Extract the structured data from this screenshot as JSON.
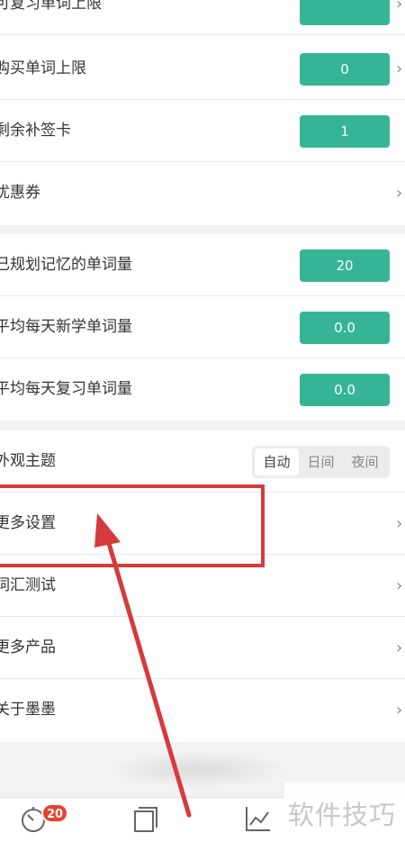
{
  "sections": {
    "top": {
      "rows": [
        {
          "label": "可复习单词上限",
          "value": "",
          "chevron": "›"
        },
        {
          "label": "购买单词上限",
          "value": "0",
          "chevron": "›"
        },
        {
          "label": "剩余补签卡",
          "value": "1",
          "chevron": ""
        },
        {
          "label": "优惠券",
          "value": "",
          "chevron": "›"
        }
      ]
    },
    "stats": {
      "rows": [
        {
          "label": "已规划记忆的单词量",
          "value": "20"
        },
        {
          "label": "平均每天新学单词量",
          "value": "0.0"
        },
        {
          "label": "平均每天复习单词量",
          "value": "0.0"
        }
      ]
    },
    "settings": {
      "theme": {
        "label": "外观主题",
        "options": [
          "自动",
          "日间",
          "夜间"
        ],
        "selected": "自动"
      },
      "rows": [
        {
          "label": "更多设置",
          "chevron": "›"
        },
        {
          "label": "词汇测试",
          "chevron": "›"
        },
        {
          "label": "更多产品",
          "chevron": "›"
        },
        {
          "label": "关于墨墨",
          "chevron": "›"
        }
      ]
    }
  },
  "tabbar": {
    "badge": "20",
    "icons": [
      "timer-icon",
      "cards-icon",
      "chart-icon"
    ]
  },
  "watermark": "软件技巧",
  "colors": {
    "accent": "#35b596",
    "highlight": "#d63a3a",
    "badge": "#e8412f"
  }
}
